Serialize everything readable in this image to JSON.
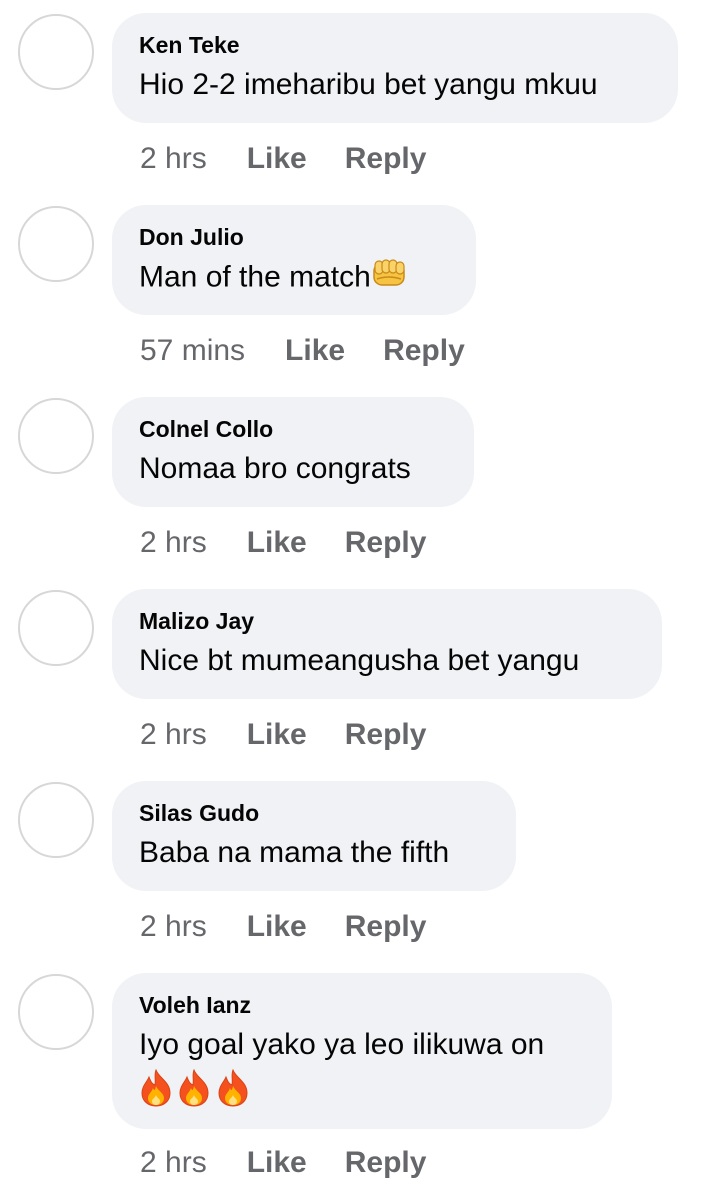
{
  "comments": [
    {
      "author": "Ken Teke",
      "text": "Hio 2-2 imeharibu bet yangu mkuu",
      "emojis": [],
      "time": "2 hrs"
    },
    {
      "author": "Don Julio",
      "text": "Man of the match",
      "emojis": [
        "fist-icon"
      ],
      "time": "57 mins"
    },
    {
      "author": "Colnel Collo",
      "text": "Nomaa bro congrats",
      "emojis": [],
      "time": "2 hrs"
    },
    {
      "author": "Malizo Jay",
      "text": "Nice bt mumeangusha bet yangu",
      "emojis": [],
      "time": "2 hrs"
    },
    {
      "author": "Silas Gudo",
      "text": "Baba na mama the fifth",
      "emojis": [],
      "time": "2 hrs"
    },
    {
      "author": "Voleh Ianz",
      "text": "Iyo goal yako ya leo ilikuwa on",
      "emojis": [
        "fire-icon",
        "fire-icon",
        "fire-icon"
      ],
      "time": "2 hrs"
    }
  ],
  "actions": {
    "like_label": "Like",
    "reply_label": "Reply"
  },
  "colors": {
    "bubble": "#f0f2f5",
    "meta_text": "#65676b",
    "author_text": "#050505"
  }
}
